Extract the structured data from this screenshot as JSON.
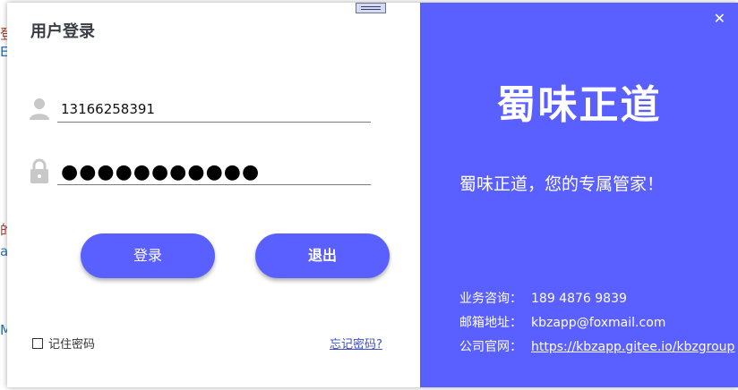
{
  "background": {
    "fragment_1": "登",
    "fragment_2": "E",
    "fragment_3": "的",
    "fragment_4": "ap",
    "fragment_5": "Ma"
  },
  "login": {
    "title": "用户登录",
    "username_value": "13166258391",
    "password_mask": "●●●●●●●●●●●",
    "login_button": "登录",
    "exit_button": "退出",
    "remember_label": "记住密码",
    "remember_checked": false,
    "forgot_link": "忘记密码?"
  },
  "brand": {
    "name": "蜀味正道",
    "slogan": "蜀味正道，您的专属管家！",
    "contacts": [
      {
        "label": "业务咨询：",
        "value": "189 4876 9839"
      },
      {
        "label": "邮箱地址：",
        "value": "kbzapp@foxmail.com"
      },
      {
        "label": "公司官网：",
        "value": "https://kbzapp.gitee.io/kbzgroup"
      }
    ]
  },
  "icons": {
    "user": "user-icon",
    "lock": "lock-icon",
    "close": "close-icon",
    "drag": "drag-handle-icon"
  },
  "colors": {
    "accent": "#5a60ff",
    "panel_text": "#ffffff",
    "link": "#3c50c8"
  }
}
